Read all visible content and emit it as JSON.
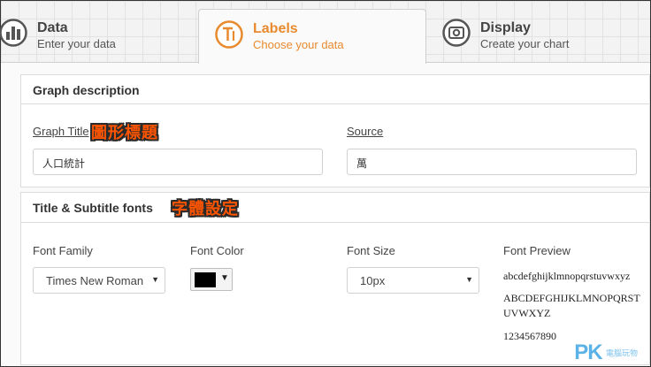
{
  "tabs": [
    {
      "title": "Data",
      "subtitle": "Enter your data",
      "icon": "bar-chart-icon"
    },
    {
      "title": "Labels",
      "subtitle": "Choose your data",
      "icon": "text-label-icon",
      "active": true
    },
    {
      "title": "Display",
      "subtitle": "Create your chart",
      "icon": "display-icon"
    }
  ],
  "accent_color": "#e88a2e",
  "graph_description": {
    "heading": "Graph description",
    "title_label": "Graph Title",
    "title_value": "人口統計",
    "title_annotation": "圖形標題",
    "source_label": "Source",
    "source_value": "萬"
  },
  "fonts": {
    "heading": "Title & Subtitle fonts",
    "annotation": "字體設定",
    "family_label": "Font Family",
    "family_value": "Times New Roman",
    "color_label": "Font Color",
    "color_value": "#000000",
    "size_label": "Font Size",
    "size_value": "10px",
    "preview_label": "Font Preview",
    "preview_lower": "abcdefghijklmnopqrstuvwxyz",
    "preview_upper": "ABCDEFGHIJKLMNOPQRSTUVWXYZ",
    "preview_digits": "1234567890"
  },
  "watermark": {
    "brand": "PK",
    "tagline": "電腦玩物"
  }
}
